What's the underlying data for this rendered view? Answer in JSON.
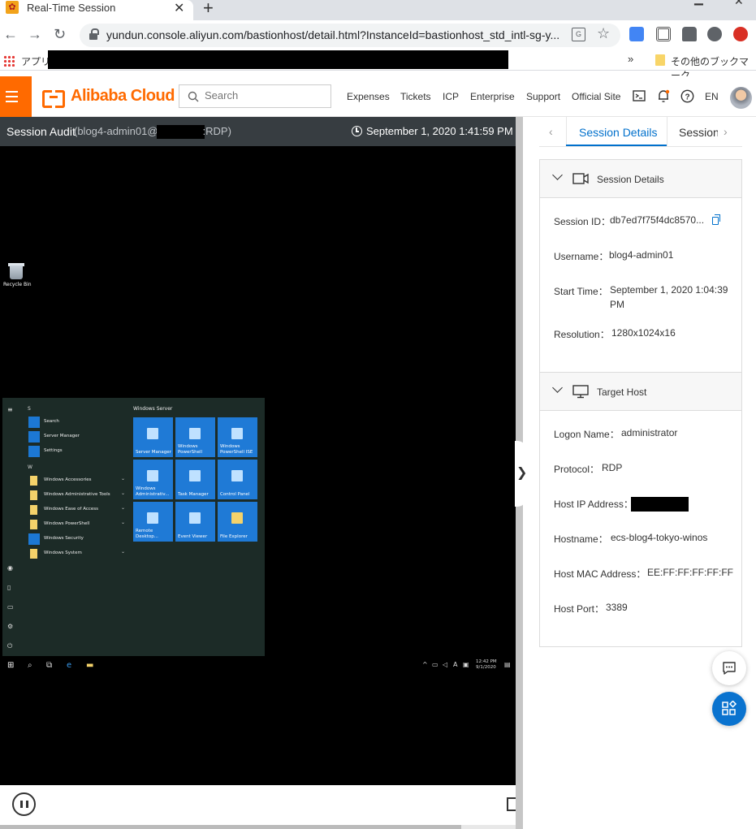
{
  "browser": {
    "tab_title": "Real-Time Session",
    "url": "yundun.console.aliyun.com/bastionhost/detail.html?InstanceId=bastionhost_std_intl-sg-y...",
    "bookmarks": {
      "apps_label": "アプリ",
      "more_label": "»",
      "other_label": "その他のブックマーク"
    }
  },
  "header": {
    "logo": "Alibaba Cloud",
    "search_placeholder": "Search",
    "nav": [
      "Expenses",
      "Tickets",
      "ICP",
      "Enterprise",
      "Support",
      "Official Site"
    ],
    "lang": "EN"
  },
  "session": {
    "title": "Session Audit",
    "subtitle_prefix": "(blog4-admin01@",
    "subtitle_suffix": ":RDP)",
    "timestamp": "September 1, 2020 1:41:59 PM"
  },
  "desktop": {
    "recycle_bin": "Recycle Bin",
    "start_menu": {
      "letters": [
        "S",
        "W"
      ],
      "items": [
        {
          "label": "Search"
        },
        {
          "label": "Server Manager"
        },
        {
          "label": "Settings"
        },
        {
          "label": "Windows Accessories"
        },
        {
          "label": "Windows Administrative Tools"
        },
        {
          "label": "Windows Ease of Access"
        },
        {
          "label": "Windows PowerShell"
        },
        {
          "label": "Windows Security"
        },
        {
          "label": "Windows System"
        }
      ],
      "group_title": "Windows Server",
      "tiles": [
        {
          "label": "Server Manager"
        },
        {
          "label": "Windows PowerShell"
        },
        {
          "label": "Windows PowerShell ISE"
        },
        {
          "label": "Windows Administrativ..."
        },
        {
          "label": "Task Manager"
        },
        {
          "label": "Control Panel"
        },
        {
          "label": "Remote Desktop..."
        },
        {
          "label": "Event Viewer"
        },
        {
          "label": "File Explorer"
        }
      ]
    },
    "taskbar": {
      "time": "12:42 PM",
      "date": "9/1/2020",
      "lang_indicator": "A"
    }
  },
  "panel": {
    "tabs": [
      "Session Details",
      "Session"
    ],
    "session_details": {
      "title": "Session Details",
      "fields": [
        {
          "label": "Session ID",
          "value": "db7ed7f75f4dc8570..."
        },
        {
          "label": "Username",
          "value": "blog4-admin01"
        },
        {
          "label": "Start Time",
          "value": "September 1, 2020 1:04:39",
          "value2": "PM"
        },
        {
          "label": "Resolution",
          "value": "1280x1024x16"
        }
      ]
    },
    "target_host": {
      "title": "Target Host",
      "fields": [
        {
          "label": "Logon Name",
          "value": "administrator"
        },
        {
          "label": "Protocol",
          "value": "RDP"
        },
        {
          "label": "Host IP Address",
          "value": ""
        },
        {
          "label": "Hostname",
          "value": "ecs-blog4-tokyo-winos"
        },
        {
          "label": "Host MAC Address",
          "value": "EE:FF:FF:FF:FF:FF"
        },
        {
          "label": "Host Port",
          "value": "3389"
        }
      ]
    }
  },
  "colors": {
    "brand": "#ff6a00",
    "link": "#0070cc",
    "session_bar": "#373d41"
  }
}
